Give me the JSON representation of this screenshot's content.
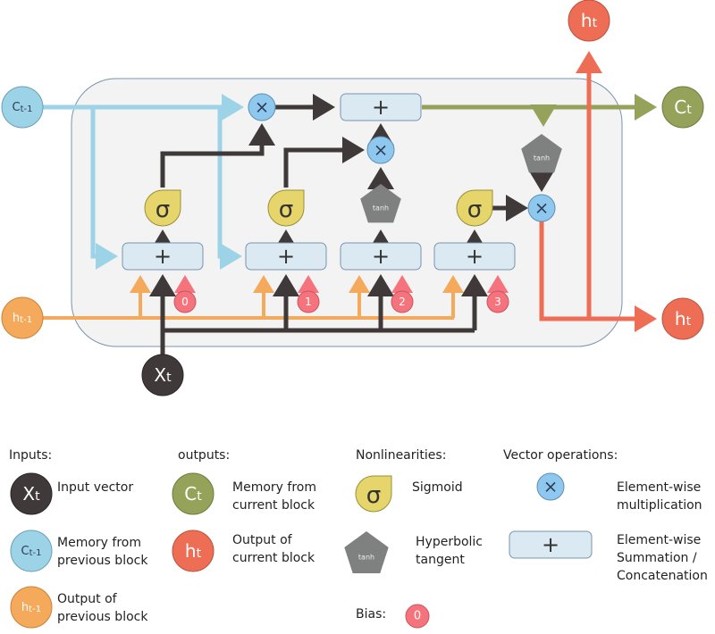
{
  "colors": {
    "cell_bg": "#f3f3f3",
    "cell_border": "#7a93ad",
    "memory_prev": "#9dd3e6",
    "memory_prev_line": "#9dd3e6",
    "hidden_prev": "#f5a95a",
    "input": "#3f3a39",
    "memory_out": "#95a25a",
    "hidden_out": "#ee6e55",
    "sigmoid": "#e6d56a",
    "tanh": "#7f8080",
    "mult": "#8ec8ee",
    "sum_box": "#dbeaf2",
    "bias": "#f5737c"
  },
  "nodes": {
    "c_prev": {
      "main": "C",
      "sub": "t-1"
    },
    "h_prev": {
      "main": "h",
      "sub": "t-1"
    },
    "x_t": {
      "main": "X",
      "sub": "t"
    },
    "c_t": {
      "main": "C",
      "sub": "t"
    },
    "h_t_top": {
      "main": "h",
      "sub": "t"
    },
    "h_t_right": {
      "main": "h",
      "sub": "t"
    }
  },
  "ops": {
    "sigmoid_symbol": "σ",
    "tanh_label": "tanh",
    "mult_symbol": "×",
    "sum_symbol": "+"
  },
  "biases": [
    "0",
    "1",
    "2",
    "3"
  ],
  "legend": {
    "inputs": {
      "heading": "Inputs:",
      "items": [
        {
          "symbol_main": "X",
          "symbol_sub": "t",
          "text": "Input vector"
        },
        {
          "symbol_main": "C",
          "symbol_sub": "t-1",
          "text": "Memory from\nprevious block"
        },
        {
          "symbol_main": "h",
          "symbol_sub": "t-1",
          "text": "Output of\nprevious block"
        }
      ]
    },
    "outputs": {
      "heading": "outputs:",
      "items": [
        {
          "symbol_main": "C",
          "symbol_sub": "t",
          "text": "Memory from\ncurrent block"
        },
        {
          "symbol_main": "h",
          "symbol_sub": "t",
          "text": "Output of\ncurrent block"
        }
      ]
    },
    "nonlinearities": {
      "heading": "Nonlinearities:",
      "items": [
        {
          "symbol": "σ",
          "text": "Sigmoid"
        },
        {
          "symbol": "tanh",
          "text": "Hyperbolic\ntangent"
        }
      ]
    },
    "vector_ops": {
      "heading": "Vector operations:",
      "items": [
        {
          "symbol": "×",
          "text": "Element-wise\nmultiplication"
        },
        {
          "symbol": "+",
          "text": "Element-wise\nSummation /\nConcatenation"
        }
      ]
    },
    "bias": {
      "heading": "Bias:",
      "symbol": "0"
    }
  }
}
